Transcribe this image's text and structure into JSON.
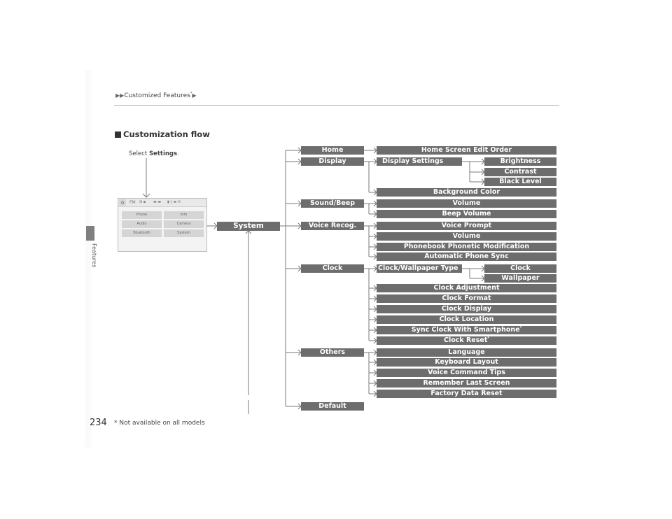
{
  "header": {
    "breadcrumb": "Customized Features",
    "breadcrumb_mark": "*"
  },
  "sidebar": {
    "label": "Features"
  },
  "section": {
    "title": "Customization flow"
  },
  "instruction": {
    "prefix": "Select ",
    "emphasis": "Settings",
    "suffix": "."
  },
  "screen": {
    "status_bar": {
      "home_icon": "home-icon",
      "source": "FM",
      "items": [
        "⊞ ▪",
        "▬ ▬",
        "▮ ▯ ▬ ✉"
      ]
    },
    "buttons": [
      "Phone",
      "Info",
      "Audio",
      "Camera",
      "Bluetooth",
      "System"
    ]
  },
  "flow": {
    "root": "System",
    "level1": [
      "Home",
      "Display",
      "Sound/Beep",
      "Voice Recog.",
      "Clock",
      "Others",
      "Default"
    ],
    "level2": {
      "home": [
        "Home Screen Edit Order"
      ],
      "display": [
        "Display Settings",
        "Background Color"
      ],
      "sound": [
        "Volume",
        "Beep Volume"
      ],
      "voice": [
        "Voice Prompt",
        "Volume",
        "Phonebook Phonetic Modification",
        "Automatic Phone Sync"
      ],
      "clock": [
        "Clock/Wallpaper Type",
        "Clock Adjustment",
        "Clock Format",
        "Clock Display",
        "Clock Location",
        "Sync Clock With Smartphone",
        "Clock Reset"
      ],
      "others": [
        "Language",
        "Keyboard Layout",
        "Voice Command Tips",
        "Remember Last Screen",
        "Factory Data Reset"
      ]
    },
    "level3": {
      "display_settings": [
        "Brightness",
        "Contrast",
        "Black Level"
      ],
      "clock_wallpaper": [
        "Clock",
        "Wallpaper"
      ]
    },
    "footnote_mark": "*"
  },
  "footer": {
    "page_number": "234",
    "note": "* Not available on all models"
  }
}
